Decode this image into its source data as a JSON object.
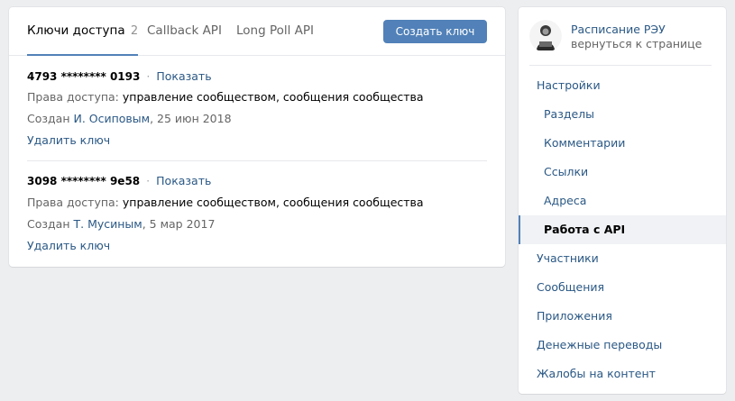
{
  "tabs": {
    "keys_label": "Ключи доступа",
    "keys_count": "2",
    "callback_label": "Callback API",
    "longpoll_label": "Long Poll API"
  },
  "create_button": "Создать ключ",
  "keys": [
    {
      "code": "4793 ******** 0193",
      "show": "Показать",
      "rights_prefix": "Права доступа:",
      "rights": "управление сообществом, сообщения сообщества",
      "created_prefix": "Создан",
      "created_by": "И. Осиповым",
      "created_date": ", 25 июн 2018",
      "delete": "Удалить ключ"
    },
    {
      "code": "3098 ******** 9e58",
      "show": "Показать",
      "rights_prefix": "Права доступа:",
      "rights": "управление сообществом, сообщения сообщества",
      "created_prefix": "Создан",
      "created_by": "Т. Мусиным",
      "created_date": ", 5 мар 2017",
      "delete": "Удалить ключ"
    }
  ],
  "group": {
    "name": "Расписание РЭУ",
    "back": "вернуться к странице"
  },
  "nav": [
    "Настройки",
    "Разделы",
    "Комментарии",
    "Ссылки",
    "Адреса",
    "Работа с API",
    "Участники",
    "Сообщения",
    "Приложения",
    "Денежные переводы",
    "Жалобы на контент"
  ],
  "colors": {
    "accent": "#5181b8",
    "link": "#2a5885",
    "background": "#edeef0"
  }
}
